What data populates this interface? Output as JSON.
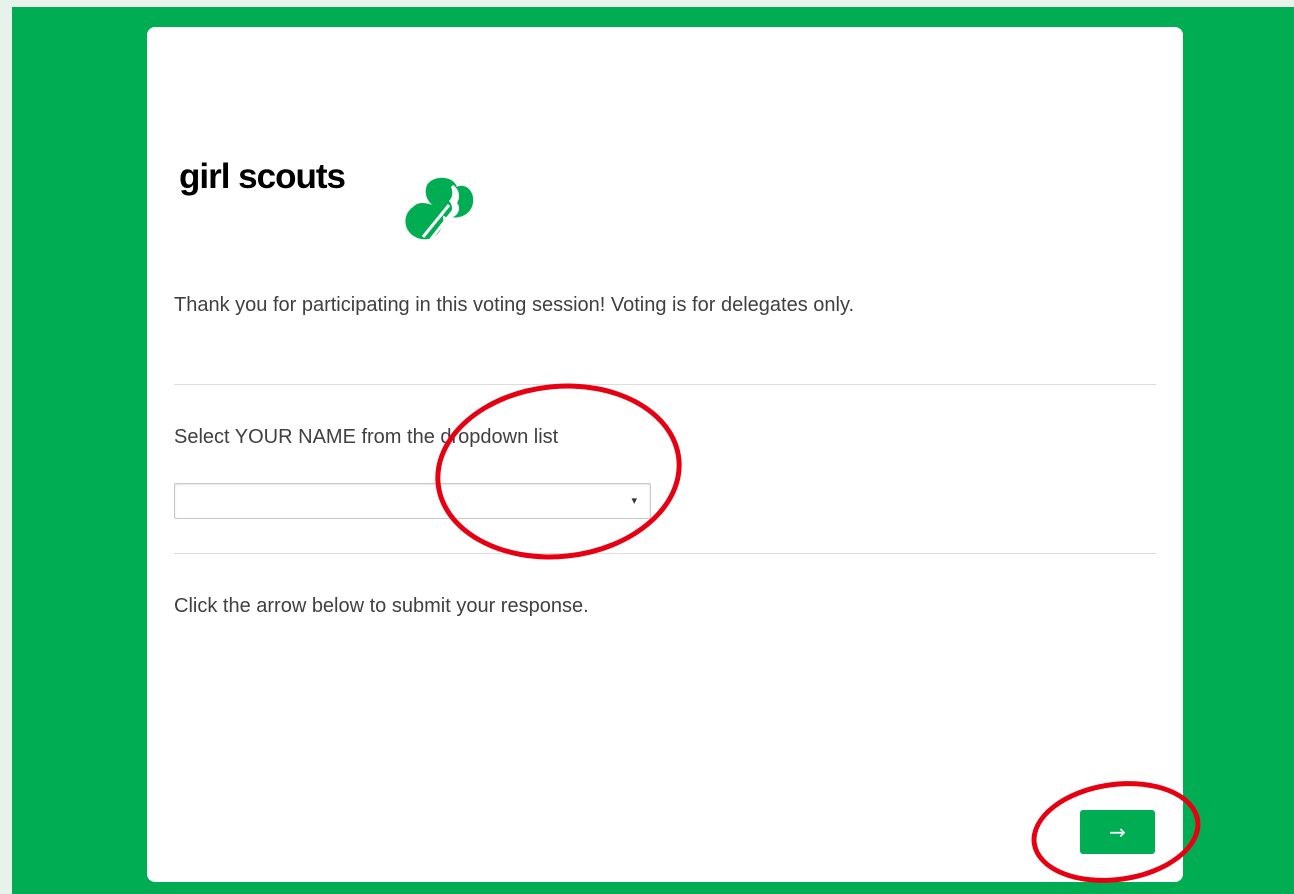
{
  "logo": {
    "text": "girl scouts",
    "icon": "trefoil-icon"
  },
  "form": {
    "intro": "Thank you for participating in this voting session! Voting is for delegates only.",
    "name_question": "Select YOUR NAME from the dropdown list",
    "name_select": {
      "value": "",
      "arrow": "▾"
    },
    "submit_instruction": "Click the arrow below to submit your response.",
    "next_button_label": "→"
  },
  "colors": {
    "background": "#00ad53",
    "card": "#ffffff",
    "button": "#00ad53",
    "annotation": "#e60012"
  }
}
